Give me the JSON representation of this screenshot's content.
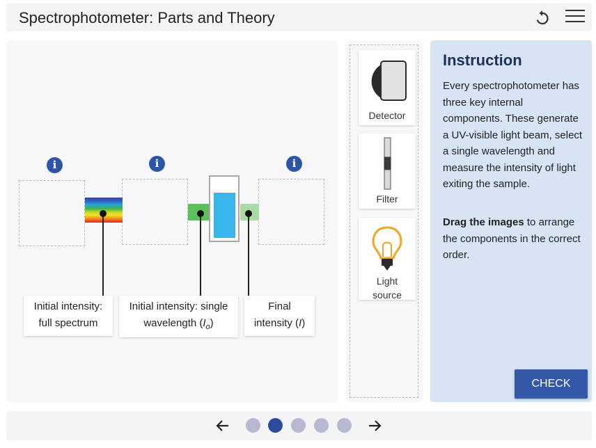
{
  "header": {
    "title": "Spectrophotometer: Parts and Theory",
    "undo_icon": "undo-icon",
    "menu_icon": "hamburger-menu-icon"
  },
  "workspace": {
    "info_icon": "info-icon",
    "labels": [
      {
        "line1": "Initial intensity:",
        "line2": "full spectrum"
      },
      {
        "line1": "Initial intensity: single",
        "line2_prefix": "wavelength (",
        "line2_symbol": "I",
        "line2_sub": "o",
        "line2_suffix": ")"
      },
      {
        "line1": "Final",
        "line2_prefix": "intensity (",
        "line2_symbol": "I",
        "line2_suffix": ")"
      }
    ],
    "colors": {
      "mono_beam": "#5cbf5a",
      "final_beam": "#a9dba6",
      "cuvette_liquid": "#38b5e9"
    }
  },
  "tray": {
    "cards": [
      {
        "label": "Detector",
        "icon": "detector-icon"
      },
      {
        "label": "Filter",
        "icon": "filter-icon"
      },
      {
        "label_line1": "Light",
        "label_line2": "source",
        "icon": "light-bulb-icon"
      }
    ]
  },
  "instruction": {
    "title": "Instruction",
    "paragraph": "Every spectrophotometer has three key internal components. These generate a UV-visible light beam, select a single wavelength and measure the intensity of light exiting the sample.",
    "drag_bold": "Drag the images",
    "drag_rest": " to arrange the components in the correct order.",
    "check_label": "CHECK"
  },
  "footer": {
    "prev_icon": "arrow-left-icon",
    "next_icon": "arrow-right-icon",
    "pages": 5,
    "current_page": 2
  }
}
